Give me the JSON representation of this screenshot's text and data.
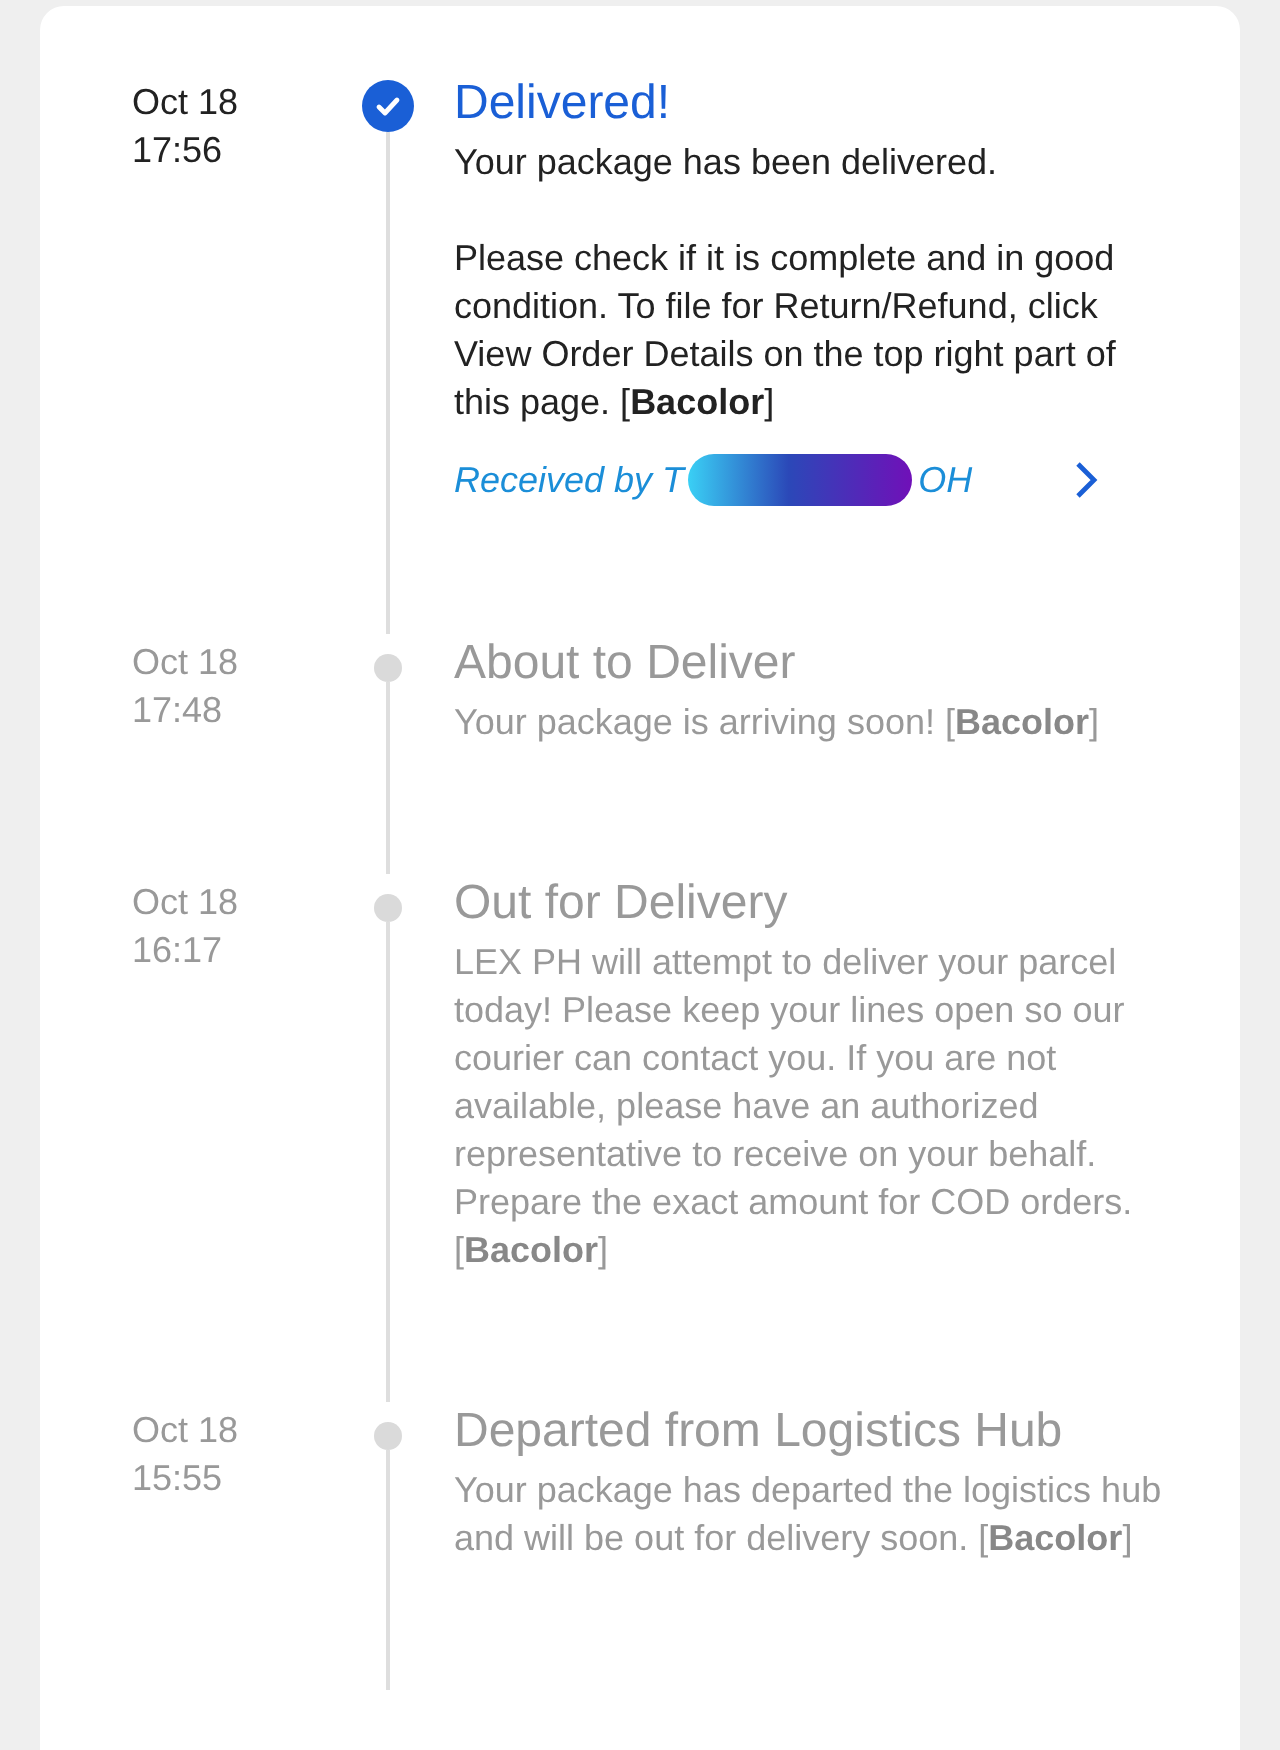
{
  "events": [
    {
      "date": "Oct 18",
      "time": "17:56",
      "title": "Delivered!",
      "active": true,
      "paragraphs": [
        "Your package has been delivered.",
        "Please check if it is complete and in good condition. To file for Return/Refund, click View Order Details on the top right part of this page. [**Bacolor**]"
      ],
      "receiver": {
        "prefix": "Received by T",
        "suffix": "OH"
      }
    },
    {
      "date": "Oct 18",
      "time": "17:48",
      "title": "About to Deliver",
      "active": false,
      "paragraphs": [
        "Your package is arriving soon! [**Bacolor**]"
      ]
    },
    {
      "date": "Oct 18",
      "time": "16:17",
      "title": "Out for Delivery",
      "active": false,
      "paragraphs": [
        "LEX PH will attempt to deliver your parcel today! Please keep your lines open so our courier can contact you. If you are not available, please have an authorized representative to receive on your behalf. Prepare the exact amount for COD orders. [**Bacolor**]"
      ]
    },
    {
      "date": "Oct 18",
      "time": "15:55",
      "title": "Departed from Logistics Hub",
      "active": false,
      "paragraphs": [
        "Your package has departed the logistics hub and will be out for delivery soon. [**Bacolor**]"
      ]
    }
  ]
}
